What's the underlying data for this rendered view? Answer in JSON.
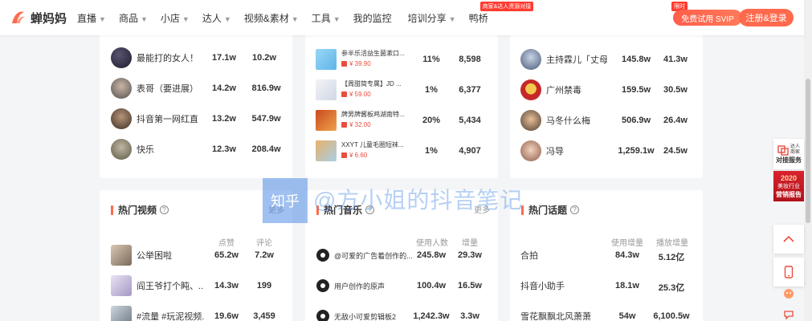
{
  "brand": {
    "name": "蝉妈妈",
    "accent": "#ff6a4d"
  },
  "nav": {
    "items": [
      "直播",
      "商品",
      "小店",
      "达人",
      "视频&素材",
      "工具",
      "我的监控",
      "培训分享",
      "鸭桥"
    ],
    "badge": "商家&达人资源对接",
    "trial_tag": "限时",
    "trial": "免费试用 SVIP",
    "register": "注册&登录"
  },
  "live_streams": [
    {
      "name": "最能打的女人！...",
      "v1": "17.1w",
      "v2": "10.2w"
    },
    {
      "name": "表哥（要进展）正...",
      "v1": "14.2w",
      "v2": "816.9w"
    },
    {
      "name": "抖音第一网红直播",
      "v1": "13.2w",
      "v2": "547.9w"
    },
    {
      "name": "快乐",
      "v1": "12.3w",
      "v2": "208.4w"
    }
  ],
  "products": [
    {
      "title": "参半乐活益生菌漱口...",
      "price": "¥ 39.90",
      "pct": "11%",
      "sales": "8,598"
    },
    {
      "title": "【周甜简专属】JD ...",
      "price": "¥ 59.00",
      "pct": "1%",
      "sales": "6,377"
    },
    {
      "title": "牌男牌酱板鸡湖南特...",
      "price": "¥ 32.00",
      "pct": "20%",
      "sales": "5,434"
    },
    {
      "title": "XXYT 儿童毛圈短袜...",
      "price": "¥ 6.60",
      "pct": "1%",
      "sales": "4,907"
    }
  ],
  "influencers": [
    {
      "name": "主持霖儿「丈母...",
      "v1": "145.8w",
      "v2": "41.3w"
    },
    {
      "name": "广州禁毒",
      "v1": "159.5w",
      "v2": "30.5w"
    },
    {
      "name": "马冬什么梅",
      "v1": "506.9w",
      "v2": "26.4w"
    },
    {
      "name": "冯导",
      "v1": "1,259.1w",
      "v2": "24.5w"
    }
  ],
  "hot_videos": {
    "title": "热门视频",
    "more": "更多",
    "col1": "点赞",
    "col2": "评论",
    "rows": [
      {
        "name": "公举困啦",
        "v1": "65.2w",
        "v2": "7.2w"
      },
      {
        "name": "阎王爷打个盹、...",
        "v1": "14.3w",
        "v2": "199"
      },
      {
        "name": "#流量 #玩泥视频...",
        "v1": "19.6w",
        "v2": "3,459"
      }
    ]
  },
  "hot_music": {
    "title": "热门音乐",
    "more": "更多",
    "col1": "使用人数",
    "col2": "增量",
    "rows": [
      {
        "name": "@可爱的广告着创作的...",
        "v1": "245.8w",
        "v2": "29.3w"
      },
      {
        "name": "用户创作的原声",
        "v1": "100.4w",
        "v2": "16.5w"
      },
      {
        "name": "无敌小可爱剪辑板2",
        "v1": "1,242.3w",
        "v2": "3.3w"
      }
    ]
  },
  "hot_topics": {
    "title": "热门话题",
    "col1": "使用增量",
    "col2": "播放增量",
    "rows": [
      {
        "name": "合拍",
        "v1": "84.3w",
        "v2": "5.12亿"
      },
      {
        "name": "抖音小助手",
        "v1": "18.1w",
        "v2": "25.3亿"
      },
      {
        "name": "雪花飘飘北风萧萧",
        "v1": "54w",
        "v2": "6,100.5w"
      }
    ]
  },
  "side": {
    "talent_small": "达人\n商家",
    "talent": "对接服务",
    "promo_year": "2020",
    "promo_line1": "美妆行业",
    "promo_line2": "营销报告"
  },
  "watermark": {
    "box": "知乎",
    "text": "@方小姐的抖音笔记"
  }
}
